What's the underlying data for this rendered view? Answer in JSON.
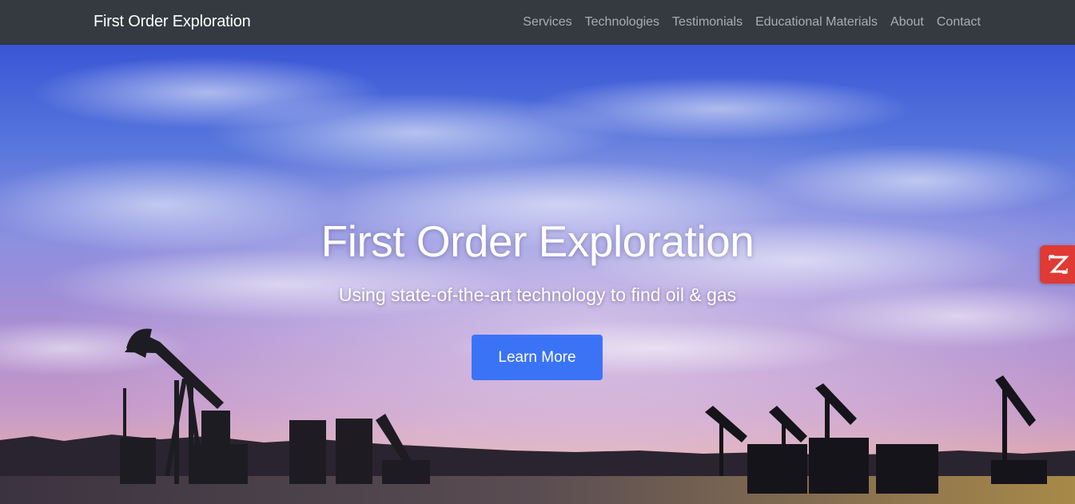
{
  "navbar": {
    "brand": "First Order Exploration",
    "links": [
      "Services",
      "Technologies",
      "Testimonials",
      "Educational Materials",
      "About",
      "Contact"
    ]
  },
  "hero": {
    "title": "First Order Exploration",
    "subtitle": "Using state-of-the-art technology to find oil & gas",
    "button_label": "Learn More",
    "background": "sky-with-oil-pumpjacks-at-sunset"
  },
  "side_widget": {
    "icon": "z-logo-icon",
    "color": "#e03a34"
  },
  "colors": {
    "navbar": "#343a40",
    "button": "#3b73f7"
  }
}
